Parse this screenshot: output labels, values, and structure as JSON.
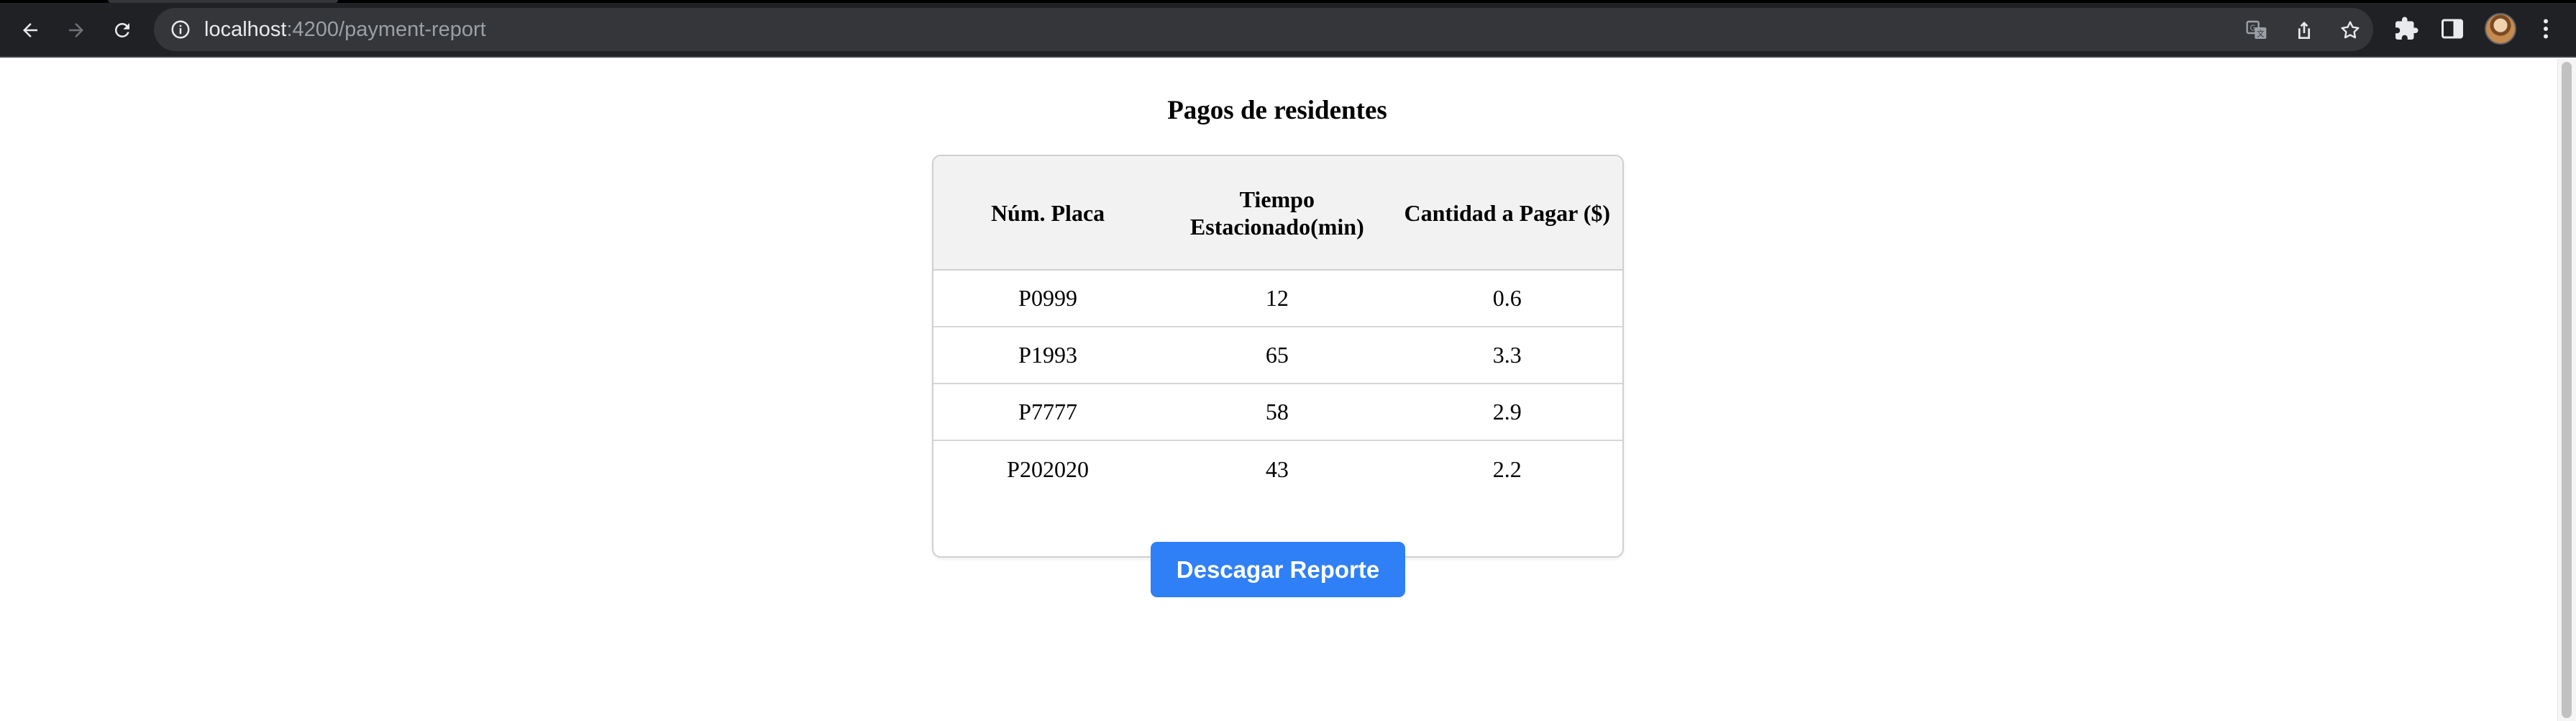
{
  "browser": {
    "url_host": "localhost",
    "url_path": ":4200/payment-report"
  },
  "report": {
    "title": "Pagos de residentes",
    "columns": [
      {
        "label": "Núm. Placa"
      },
      {
        "label": "Tiempo Estacionado(min)"
      },
      {
        "label": "Cantidad a Pagar ($)"
      }
    ],
    "rows": [
      {
        "plate": "P0999",
        "minutes": "12",
        "amount": "0.6"
      },
      {
        "plate": "P1993",
        "minutes": "65",
        "amount": "3.3"
      },
      {
        "plate": "P7777",
        "minutes": "58",
        "amount": "2.9"
      },
      {
        "plate": "P202020",
        "minutes": "43",
        "amount": "2.2"
      }
    ],
    "download_label": "Descagar Reporte"
  },
  "colors": {
    "accent": "#2f80f6",
    "chrome_bg": "#202124",
    "omnibox_bg": "#35363a",
    "header_bg": "#f2f2f2"
  },
  "icons": {
    "back": "arrow-left-icon",
    "forward": "arrow-right-icon",
    "reload": "reload-icon",
    "site_info": "info-circle-icon",
    "translate": "translate-icon",
    "share": "share-icon",
    "bookmark": "star-icon",
    "extensions": "puzzle-icon",
    "side_panel": "side-panel-icon",
    "menu": "kebab-menu-icon"
  }
}
